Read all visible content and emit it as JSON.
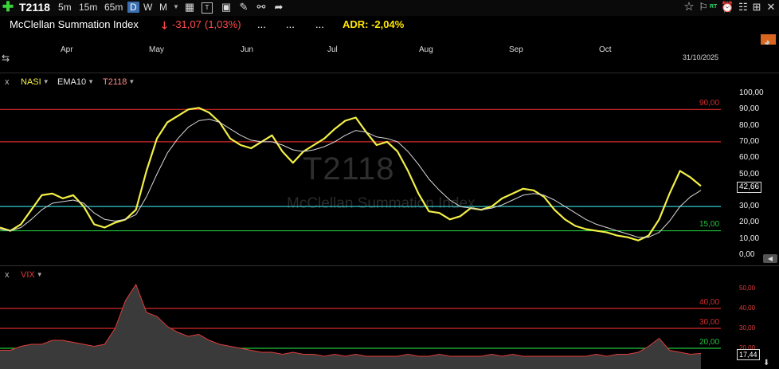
{
  "toolbar": {
    "symbol": "T2118",
    "intervals": [
      {
        "label": "5m",
        "selected": false
      },
      {
        "label": "15m",
        "selected": false
      },
      {
        "label": "65m",
        "selected": false
      },
      {
        "label": "D",
        "selected": true
      },
      {
        "label": "W",
        "selected": false
      },
      {
        "label": "M",
        "selected": false
      }
    ],
    "rt_label": "RT"
  },
  "header": {
    "title": "McClellan Summation Index",
    "change": "-31,07",
    "change_pct": "(1,03%)",
    "dots": [
      "...",
      "...",
      "..."
    ],
    "adr": "ADR: -2,04%"
  },
  "time_axis": {
    "months": [
      "Apr",
      "May",
      "Jun",
      "Jul",
      "Aug",
      "Sep",
      "Oct"
    ],
    "end_date": "31/10/2025"
  },
  "panel_main": {
    "close_label": "x",
    "indicators": [
      "NASI",
      "EMA10",
      "T2118"
    ],
    "watermark_symbol": "T2118",
    "watermark_title": "McClellan Summation Index",
    "y_ticks": [
      "100,00",
      "90,00",
      "80,00",
      "70,00",
      "60,00",
      "50,00",
      "40,00",
      "30,00",
      "20,00",
      "10,00",
      "0,00"
    ],
    "level_labels": [
      "90,00",
      "15,00"
    ],
    "current_value": "42,66"
  },
  "panel_vix": {
    "close_label": "x",
    "indicator": "VIX",
    "y_ticks": [
      "50,00",
      "40,00",
      "30,00",
      "20,00"
    ],
    "level_labels": [
      "40,00",
      "30,00",
      "20,00"
    ],
    "current_value": "17,44"
  },
  "colors": {
    "background": "#000000",
    "primary_line": "#f4f046",
    "ema_line": "#d8d8d8",
    "level_red": "#d42b2b",
    "level_green": "#22c33a",
    "level_cyan": "#33c6c9",
    "down_red": "#ff4a4a",
    "adr_yellow": "#ffe600"
  },
  "chart_data": [
    {
      "type": "line",
      "series": [
        {
          "name": "NASI",
          "values": [
            17,
            15,
            19,
            28,
            37,
            38,
            35,
            37,
            30,
            19,
            17,
            20,
            22,
            28,
            52,
            72,
            82,
            86,
            90,
            91,
            88,
            82,
            72,
            68,
            66,
            70,
            74,
            64,
            57,
            64,
            68,
            72,
            78,
            83,
            85,
            76,
            68,
            70,
            64,
            52,
            38,
            27,
            26,
            22,
            24,
            29,
            28,
            30,
            35,
            38,
            41,
            40,
            36,
            28,
            22,
            18,
            16,
            15,
            14,
            12,
            11,
            9,
            12,
            22,
            38,
            52,
            48,
            42.66
          ]
        },
        {
          "name": "EMA10",
          "values": [
            16,
            15,
            17,
            22,
            28,
            32,
            33,
            34,
            32,
            26,
            22,
            21,
            22,
            25,
            36,
            50,
            63,
            72,
            79,
            83,
            84,
            82,
            78,
            74,
            71,
            70,
            70,
            68,
            65,
            64,
            65,
            67,
            70,
            74,
            77,
            76,
            73,
            72,
            70,
            64,
            56,
            47,
            40,
            34,
            30,
            29,
            28,
            29,
            31,
            34,
            37,
            38,
            37,
            34,
            30,
            26,
            22,
            19,
            17,
            15,
            13,
            11,
            11,
            14,
            21,
            30,
            36,
            40
          ]
        }
      ],
      "ylim": [
        0,
        100
      ],
      "levels": [
        90,
        70,
        30,
        15
      ]
    },
    {
      "type": "area",
      "series": [
        {
          "name": "VIX",
          "values": [
            19,
            19,
            21,
            22,
            22,
            24,
            24,
            23,
            22,
            21,
            22,
            30,
            44,
            52,
            38,
            36,
            31,
            28,
            26,
            27,
            24,
            22,
            21,
            20,
            19,
            18,
            18,
            17,
            18,
            17,
            17,
            16,
            17,
            16,
            17,
            16,
            16,
            16,
            16,
            17,
            16,
            16,
            17,
            16,
            16,
            16,
            16,
            17,
            16,
            17,
            16,
            16,
            16,
            16,
            16,
            16,
            16,
            17,
            16,
            17,
            17,
            18,
            21,
            25,
            19,
            18,
            17,
            17.44
          ]
        }
      ],
      "ylim": [
        15,
        55
      ],
      "levels": [
        40,
        30,
        20
      ]
    }
  ]
}
